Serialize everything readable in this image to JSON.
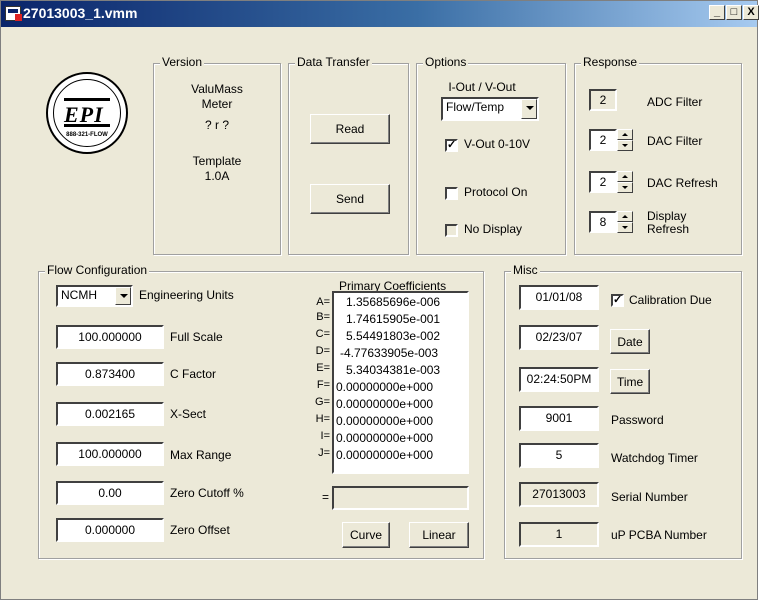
{
  "window": {
    "title": "27013003_1.vmm",
    "min": "_",
    "max": "□",
    "close": "X"
  },
  "logo": {
    "text": "EPI",
    "phone": "888-321-FLOW"
  },
  "version": {
    "label": "Version",
    "product_line1": "ValuMass",
    "product_line2": "Meter",
    "version_value": "? r ?",
    "template_label": "Template",
    "template_value": "1.0A"
  },
  "data_transfer": {
    "label": "Data Transfer",
    "read": "Read",
    "send": "Send"
  },
  "options": {
    "label": "Options",
    "output_label": "I-Out / V-Out",
    "output_select": "Flow/Temp",
    "vout_010": {
      "label": "V-Out 0-10V",
      "checked": true
    },
    "protocol_on": {
      "label": "Protocol On",
      "checked": false
    },
    "no_display": {
      "label": "No Display",
      "checked": false
    }
  },
  "response": {
    "label": "Response",
    "adc_filter": {
      "value": "2",
      "label": "ADC Filter"
    },
    "dac_filter": {
      "value": "2",
      "label": "DAC Filter"
    },
    "dac_refresh": {
      "value": "2",
      "label": "DAC Refresh"
    },
    "display_refresh": {
      "value": "8",
      "label_line1": "Display",
      "label_line2": "Refresh"
    }
  },
  "flow_config": {
    "label": "Flow Configuration",
    "units_select": "NCMH",
    "units_label": "Engineering Units",
    "full_scale": {
      "value": "100.000000",
      "label": "Full Scale"
    },
    "c_factor": {
      "value": "0.873400",
      "label": "C Factor"
    },
    "x_sect": {
      "value": "0.002165",
      "label": "X-Sect"
    },
    "max_range": {
      "value": "100.000000",
      "label": "Max Range"
    },
    "zero_cutoff": {
      "value": "0.00",
      "label": "Zero Cutoff %"
    },
    "zero_offset": {
      "value": "0.000000",
      "label": "Zero Offset"
    }
  },
  "coefficients": {
    "label": "Primary Coefficients",
    "rows": [
      {
        "letter": "A=",
        "value": "1.35685696e-006"
      },
      {
        "letter": "B=",
        "value": "1.74615905e-001"
      },
      {
        "letter": "C=",
        "value": "5.54491803e-002"
      },
      {
        "letter": "D=",
        "value": "-4.77633905e-003"
      },
      {
        "letter": "E=",
        "value": "5.34034381e-003"
      },
      {
        "letter": "F=",
        "value": "0.00000000e+000"
      },
      {
        "letter": "G=",
        "value": "0.00000000e+000"
      },
      {
        "letter": "H=",
        "value": "0.00000000e+000"
      },
      {
        "letter": "I=",
        "value": "0.00000000e+000"
      },
      {
        "letter": "J=",
        "value": "0.00000000e+000"
      }
    ],
    "eq_label": "=",
    "curve": "Curve",
    "linear": "Linear"
  },
  "misc": {
    "label": "Misc",
    "cal_date": "01/01/08",
    "cal_due": {
      "label": "Calibration Due",
      "checked": true
    },
    "date_value": "02/23/07",
    "date_button": "Date",
    "time_value": "02:24:50PM",
    "time_button": "Time",
    "password": {
      "value": "9001",
      "label": "Password"
    },
    "watchdog": {
      "value": "5",
      "label": "Watchdog Timer"
    },
    "serial": {
      "value": "27013003",
      "label": "Serial Number"
    },
    "pcba": {
      "value": "1",
      "label": "uP PCBA Number"
    }
  }
}
